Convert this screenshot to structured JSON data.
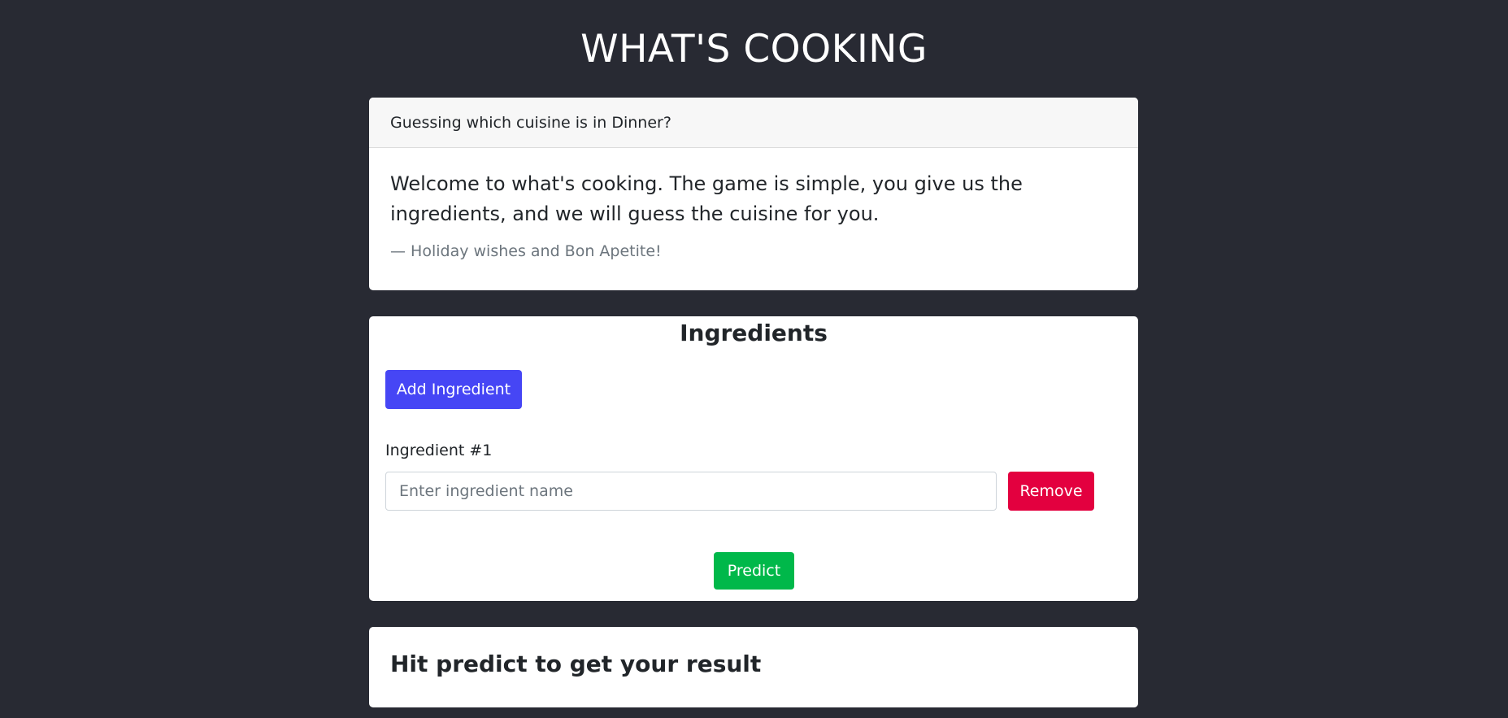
{
  "app": {
    "title": "WHAT'S COOKING"
  },
  "intro": {
    "header": "Guessing which cuisine is in Dinner?",
    "text": "Welcome to what's cooking. The game is simple, you give us the ingredients, and we will guess the cuisine for you.",
    "footer": "— Holiday wishes and Bon Apetite!"
  },
  "ingredients": {
    "title": "Ingredients",
    "add_label": "Add Ingredient",
    "items": [
      {
        "label": "Ingredient #1",
        "value": "",
        "placeholder": "Enter ingredient name",
        "remove_label": "Remove"
      }
    ],
    "predict_label": "Predict"
  },
  "result": {
    "text": "Hit predict to get your result"
  },
  "colors": {
    "background": "#282a33",
    "add_button": "#4646f5",
    "remove_button": "#e3003f",
    "predict_button": "#00b84a"
  }
}
